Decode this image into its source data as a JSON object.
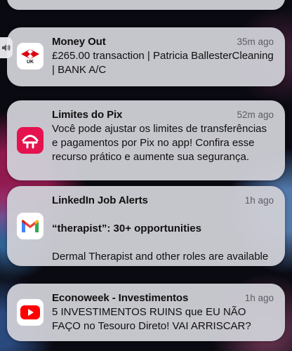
{
  "notifications": [
    {
      "id": "money-out",
      "title": "Money Out",
      "time": "35m ago",
      "body": "£265.00 transaction | Patricia BallesterCleaning | BANK A/C",
      "icon": "hsbc-uk-logo",
      "icon_label": "UK",
      "accent": "#db0011"
    },
    {
      "id": "pix",
      "title": "Limites do Pix",
      "time": "52m ago",
      "body": "Você pode ajustar os limites de transferências e pagamentos por Pix no app! Confira esse recurso prático e aumente sua segurança.",
      "icon": "bradesco-logo",
      "accent": "#e4124f"
    },
    {
      "id": "linkedin",
      "title": "LinkedIn Job Alerts",
      "time": "1h ago",
      "headline": "“therapist”: 30+ opportunities",
      "body": "Dermal Therapist and other roles are available",
      "icon": "gmail-icon"
    },
    {
      "id": "econoweek",
      "title": "Econoweek - Investimentos",
      "time": "1h ago",
      "body": "5 INVESTIMENTOS RUINS que EU NÃO FAÇO no Tesouro Direto! VAI ARRISCAR?",
      "icon": "youtube-icon",
      "accent": "#ff0000"
    }
  ],
  "volume_indicator": {
    "icon": "speaker-icon"
  }
}
